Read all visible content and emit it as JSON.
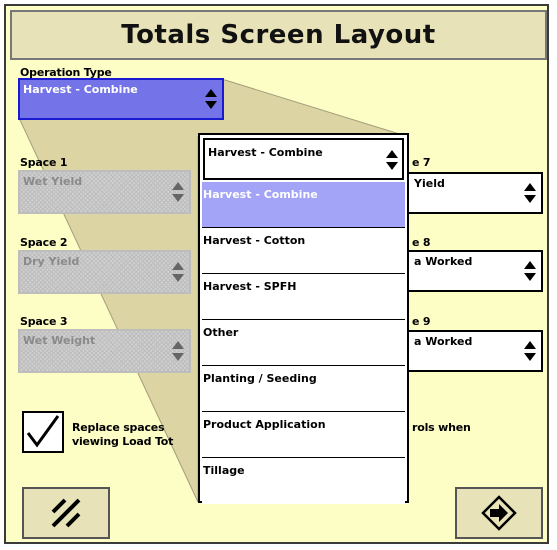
{
  "title": "Totals Screen Layout",
  "operation": {
    "label": "Operation Type",
    "value": "Harvest - Combine"
  },
  "spaces_left": [
    {
      "label": "Space 1",
      "value": "Wet Yield"
    },
    {
      "label": "Space 2",
      "value": "Dry Yield"
    },
    {
      "label": "Space 3",
      "value": "Wet Weight"
    }
  ],
  "spaces_right": [
    {
      "label": "e 7",
      "value": "Yield"
    },
    {
      "label": "e 8",
      "value": "a Worked"
    },
    {
      "label": "e 9",
      "value": "a Worked"
    }
  ],
  "checkbox": {
    "line1_left": "Replace spaces",
    "line1_right": "rols when",
    "line2_left": "viewing Load Tot"
  },
  "dropdown_list": {
    "header": "Harvest - Combine",
    "options": [
      "Harvest - Combine",
      "Harvest - Cotton",
      "Harvest - SPFH",
      "Other",
      "Planting / Seeding",
      "Product Application",
      "Tillage"
    ],
    "selected_index": 0
  },
  "colors": {
    "background": "#fdfdc6",
    "selection": "#7474e8",
    "highlight": "#a3a3f7"
  },
  "icons": {
    "left_button": "reset-icon",
    "right_button": "enter-icon"
  }
}
